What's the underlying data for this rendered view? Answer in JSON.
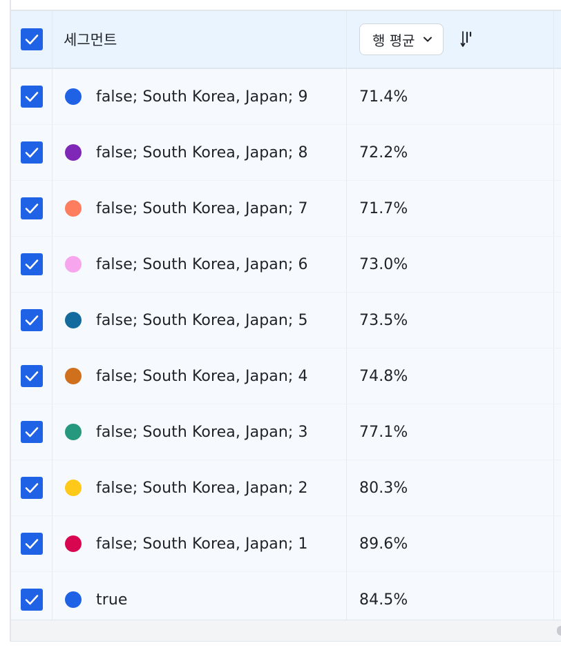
{
  "header": {
    "segment_label": "세그먼트",
    "aggregation_label": "행 평균"
  },
  "rows": [
    {
      "label": "false; South Korea, Japan; 9",
      "value": "71.4%",
      "color": "#1f62e6"
    },
    {
      "label": "false; South Korea, Japan; 8",
      "value": "72.2%",
      "color": "#7f27b6"
    },
    {
      "label": "false; South Korea, Japan; 7",
      "value": "71.7%",
      "color": "#ff7d5f"
    },
    {
      "label": "false; South Korea, Japan; 6",
      "value": "73.0%",
      "color": "#f7a6ee"
    },
    {
      "label": "false; South Korea, Japan; 5",
      "value": "73.5%",
      "color": "#136a9c"
    },
    {
      "label": "false; South Korea, Japan; 4",
      "value": "74.8%",
      "color": "#d06f1c"
    },
    {
      "label": "false; South Korea, Japan; 3",
      "value": "77.1%",
      "color": "#26987e"
    },
    {
      "label": "false; South Korea, Japan; 2",
      "value": "80.3%",
      "color": "#ffc91a"
    },
    {
      "label": "false; South Korea, Japan; 1",
      "value": "89.6%",
      "color": "#d8064f"
    },
    {
      "label": "true",
      "value": "84.5%",
      "color": "#1f62e6"
    }
  ],
  "icons": {
    "checkbox": "check-icon",
    "dropdown": "chevron-down-icon",
    "sort": "sort-icon"
  }
}
